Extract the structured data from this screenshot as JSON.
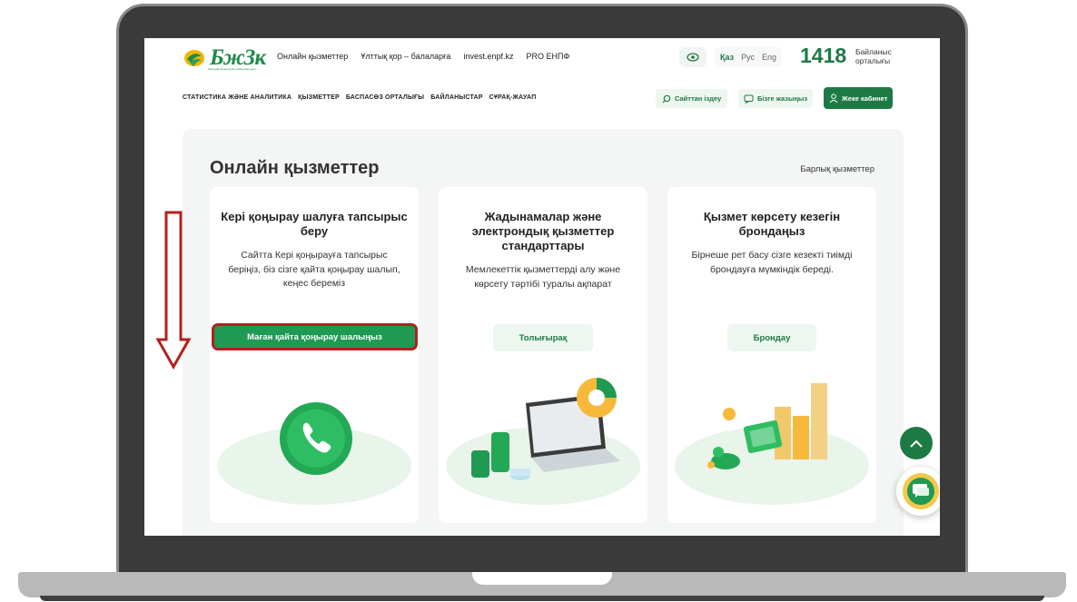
{
  "header": {
    "logo_text": "БжЗк",
    "logo_tagline": "бірыңғай жинақтаушы зейнетақы қоры",
    "top_links": [
      "Онлайн қызметтер",
      "Ұлттық қор – балаларға",
      "invest.enpf.kz",
      "PRO ЕНПФ"
    ],
    "languages": {
      "active": "Қаз",
      "others": [
        "Рус",
        "Eng"
      ]
    },
    "hotline_number": "1418",
    "hotline_label": "Байланыс орталығы",
    "main_nav": [
      "СТАТИСТИКА ЖӘНЕ АНАЛИТИКА",
      "ҚЫЗМЕТТЕР",
      "БАСПАСӨЗ ОРТАЛЫҒЫ",
      "БАЙЛАНЫСТАР",
      "СҰРАҚ-ЖАУАП"
    ],
    "search_label": "Сайттан іздеу",
    "write_label": "Бізге жазыңыз",
    "cabinet_label": "Жеке кабинет"
  },
  "services": {
    "title": "Онлайн қызметтер",
    "all_link": "Барлық қызметтер",
    "cards": [
      {
        "title": "Кері қоңырау шалуға тапсырыс беру",
        "description": "Сайтта Кері қоңырауға тапсырыс беріңіз, біз сізге қайта қоңырау шалып, кеңес береміз",
        "button": "Маған қайта қоңырау шалыңыз"
      },
      {
        "title": "Жадынамалар және электрондық қызметтер стандарттары",
        "description": "Мемлекеттік қызметтерді алу және көрсету тәртібі туралы ақпарат",
        "button": "Толығырақ"
      },
      {
        "title": "Қызмет көрсету кезегін брондаңыз",
        "description": "Бірнеше рет басу сізге кезекті тиімді брондауға мүмкіндік береді.",
        "button": "Брондау"
      }
    ]
  },
  "colors": {
    "brand_green": "#1e7a45",
    "button_green": "#1f9a53",
    "highlight_red": "#b41f1f",
    "panel_bg": "#f3f6f5"
  },
  "icons": [
    "eye-icon",
    "search-icon",
    "chat-bubble-icon",
    "user-icon",
    "phone-icon",
    "laptop-icon",
    "coins-icon",
    "chevron-up-icon",
    "chat-support-icon",
    "down-arrow-icon"
  ]
}
